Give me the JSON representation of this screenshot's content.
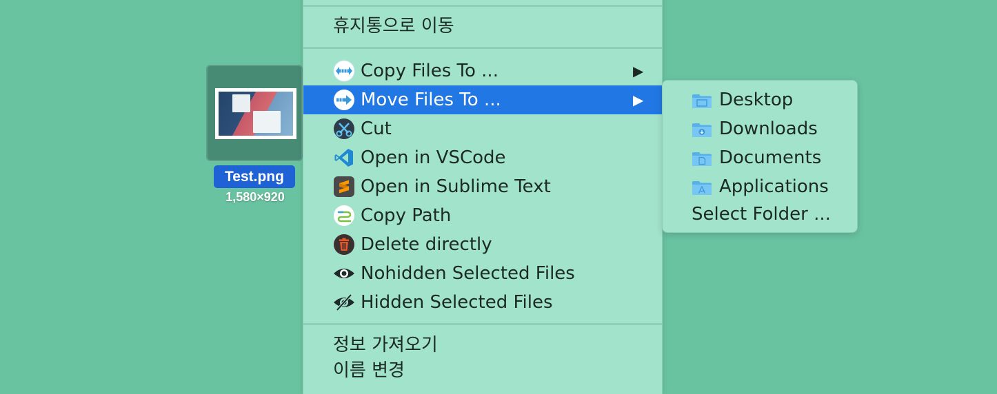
{
  "desktop": {
    "file": {
      "name": "Test.png",
      "dimensions": "1,580×920"
    }
  },
  "context_menu": {
    "top_item": "휴지통으로 이동",
    "items": [
      {
        "label": "Copy Files To ...",
        "icon": "copy-files-icon",
        "has_submenu": true
      },
      {
        "label": "Move Files To ...",
        "icon": "move-files-icon",
        "has_submenu": true,
        "highlighted": true
      },
      {
        "label": "Cut",
        "icon": "scissors-icon"
      },
      {
        "label": "Open in VSCode",
        "icon": "vscode-icon"
      },
      {
        "label": "Open in Sublime Text",
        "icon": "sublime-text-icon"
      },
      {
        "label": "Copy Path",
        "icon": "copy-path-icon"
      },
      {
        "label": "Delete directly",
        "icon": "trash-icon"
      },
      {
        "label": "Nohidden Selected Files",
        "icon": "eye-icon"
      },
      {
        "label": "Hidden Selected Files",
        "icon": "eye-slash-icon"
      }
    ],
    "bottom_items": [
      "정보 가져오기",
      "이름 변경"
    ],
    "submenu_arrow": "▶"
  },
  "submenu": {
    "items": [
      {
        "label": "Desktop",
        "icon": "desktop-folder-icon"
      },
      {
        "label": "Downloads",
        "icon": "downloads-folder-icon"
      },
      {
        "label": "Documents",
        "icon": "documents-folder-icon"
      },
      {
        "label": "Applications",
        "icon": "applications-folder-icon"
      }
    ],
    "select_folder": "Select Folder ..."
  },
  "colors": {
    "desktop_bg": "#69c3a0",
    "menu_bg": "#a2e3cc",
    "highlight": "#2177e3",
    "selection_label": "#1f62d6"
  }
}
